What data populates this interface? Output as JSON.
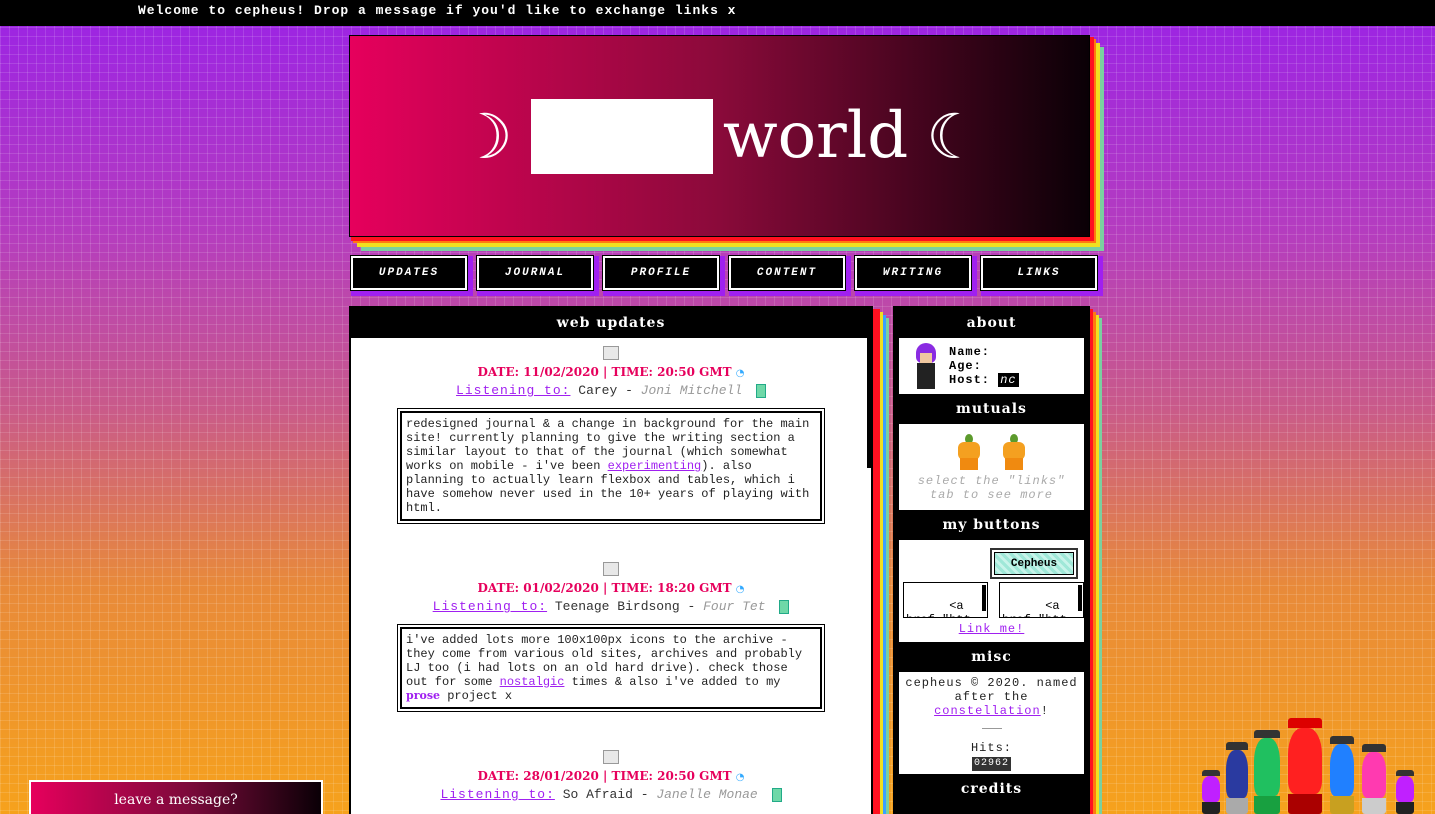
{
  "marquee": {
    "text": "Welcome to cepheus! Drop a message if you'd like to exchange links x"
  },
  "header": {
    "moon_left": "☽",
    "title_word": "world",
    "moon_right": "☾"
  },
  "nav": {
    "items": [
      "UPDATES",
      "JOURNAL",
      "PROFILE",
      "CONTENT",
      "WRITING",
      "LINKS"
    ]
  },
  "main": {
    "title": "web updates",
    "posts": [
      {
        "date": "DATE: 11/02/2020 | TIME: 20:50 GMT",
        "listening_label": "Listening to:",
        "song": "Carey",
        "sep": " - ",
        "artist": "Joni Mitchell",
        "text_before": "redesigned journal & a change in background for the main site! currently planning to give the writing section a similar layout to that of the journal (which somewhat works on mobile - i've been ",
        "link": "experimenting",
        "text_after": "). also planning to actually learn flexbox and tables, which i have somehow never used in the 10+ years of playing with html."
      },
      {
        "date": "DATE: 01/02/2020 | TIME: 18:20 GMT",
        "listening_label": "Listening to:",
        "song": "Teenage Birdsong",
        "sep": " - ",
        "artist": "Four Tet",
        "text_before": "i've added lots more 100x100px icons to the archive - they come from various old sites, archives and probably LJ too (i had lots on an old hard drive). check those out for some ",
        "link": "nostalgic",
        "text_mid": " times & also i've added to my ",
        "prose": "prose",
        "text_after": " project x"
      },
      {
        "date": "DATE: 28/01/2020 | TIME: 20:50 GMT",
        "listening_label": "Listening to:",
        "song": "So Afraid",
        "sep": " - ",
        "artist": "Janelle Monae"
      }
    ]
  },
  "sidebar": {
    "about": {
      "title": "about",
      "name_label": "Name:",
      "age_label": "Age:",
      "host_label": "Host:",
      "host_value": "nc"
    },
    "mutuals": {
      "title": "mutuals",
      "note": "select the \"links\" tab to see more"
    },
    "buttons": {
      "title": "my buttons",
      "button_text": "Cepheus",
      "code1": "<a\nhref=\"htt",
      "code2": "<a\nhref=\"htt",
      "link_me": "Link me!"
    },
    "misc": {
      "title": "misc",
      "credit_before": "cepheus © 2020. named after the ",
      "credit_link": "constellation",
      "credit_after": "!",
      "hits_label": "Hits:",
      "hits_value": "02962"
    },
    "credits": {
      "title": "credits"
    }
  },
  "widget": {
    "leave_message": "leave a message?"
  },
  "colors": {
    "accent_pink": "#e6005c",
    "accent_purple": "#a020f0",
    "bg_top": "#9a22e6",
    "bg_bottom": "#f6a21c"
  }
}
